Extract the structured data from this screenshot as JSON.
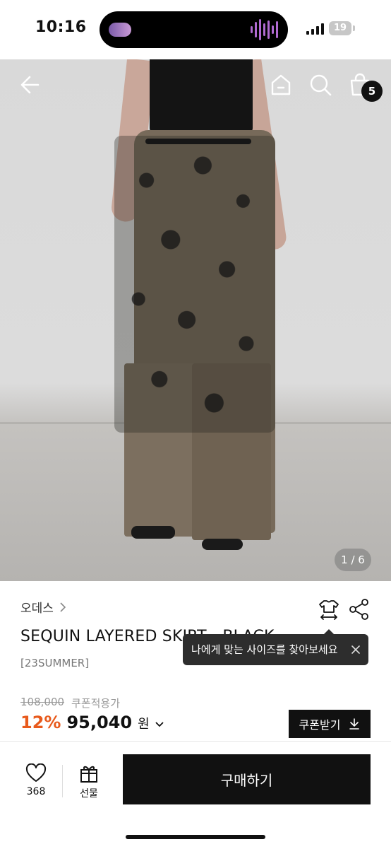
{
  "status": {
    "time": "10:16",
    "battery": "19"
  },
  "hero": {
    "page_indicator": "1 / 6",
    "cart_count": "5"
  },
  "product": {
    "brand": "오데스",
    "title": "SEQUIN LAYERED SKIRT - BLACK",
    "subtitle": "[23SUMMER]",
    "original_price": "108,000",
    "coupon_price_label": "쿠폰적용가",
    "discount": "12%",
    "price": "95,040",
    "currency": "원",
    "coupon_button": "쿠폰받기"
  },
  "tooltip": {
    "text": "나에게 맞는 사이즈를 찾아보세요"
  },
  "bottom_bar": {
    "like_count": "368",
    "gift_label": "선물",
    "buy_label": "구매하기"
  },
  "icons": [
    "back-arrow-icon",
    "home-icon",
    "search-icon",
    "shopping-bag-icon",
    "chevron-right-icon",
    "size-guide-icon",
    "share-icon",
    "close-icon",
    "chevron-down-icon",
    "download-icon",
    "heart-icon",
    "gift-icon"
  ]
}
